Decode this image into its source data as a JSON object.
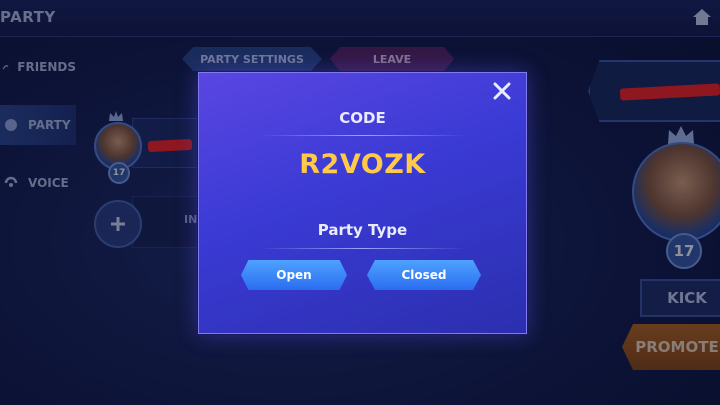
{
  "header": {
    "title": "PARTY"
  },
  "sidebar": {
    "items": [
      {
        "label": "FRIENDS",
        "icon": "wave-icon"
      },
      {
        "label": "PARTY",
        "icon": "party-icon"
      },
      {
        "label": "VOICE",
        "icon": "voice-icon"
      }
    ]
  },
  "top_buttons": {
    "settings": "PARTY SETTINGS",
    "leave": "LEAVE"
  },
  "party": {
    "member_level": "17",
    "invite_label": "IN"
  },
  "player": {
    "level": "17",
    "kick": "KICK",
    "promote": "PROMOTE"
  },
  "modal": {
    "code_label": "CODE",
    "code_value": "R2VOZK",
    "type_label": "Party Type",
    "open_label": "Open",
    "closed_label": "Closed"
  },
  "colors": {
    "accent": "#ffc94a",
    "modal_bg": "#3a3ad4",
    "promote": "#b9681f",
    "redaction": "#ff2424"
  }
}
